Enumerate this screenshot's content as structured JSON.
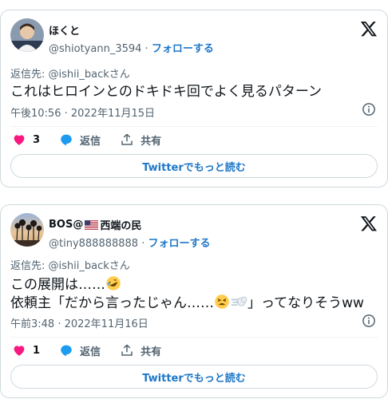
{
  "tweets": [
    {
      "display_name": "ほくと",
      "handle": "@shiotyann_3594",
      "separator": "·",
      "follow_label": "フォローする",
      "reply_to_label": "返信先: ",
      "reply_to_handle": "@ishii_backさん",
      "text_lines": [
        "これはヒロインとのドキドキ回でよく見るパターン"
      ],
      "timestamp": "午後10:56 · 2022年11月15日",
      "like_count": "3",
      "reply_label": "返信",
      "share_label": "共有",
      "read_more_label": "Twitterでもっと読む"
    },
    {
      "display_name_prefix": "BOS@",
      "display_name_suffix": "西端の民",
      "handle": "@tiny888888888",
      "separator": "·",
      "follow_label": "フォローする",
      "reply_to_label": "返信先: ",
      "reply_to_handle": "@ishii_backさん",
      "text_line1": "この展開は……",
      "text_line2_a": "依頼主「だから言ったじゃん……",
      "text_line2_b": "」ってなりそうww",
      "timestamp": "午前3:48 · 2022年11月16日",
      "like_count": "1",
      "reply_label": "返信",
      "share_label": "共有",
      "read_more_label": "Twitterでもっと読む"
    }
  ],
  "colors": {
    "link": "#1d77c8",
    "like": "#f91880",
    "reply": "#1d9bf0",
    "muted": "#536471",
    "border": "#cfd9de"
  },
  "icons": [
    "x-logo-icon",
    "info-icon",
    "heart-icon",
    "reply-bubble-icon",
    "share-icon",
    "us-flag-icon",
    "rolling-laughing-emoji",
    "tired-face-emoji",
    "dash-emoji"
  ]
}
